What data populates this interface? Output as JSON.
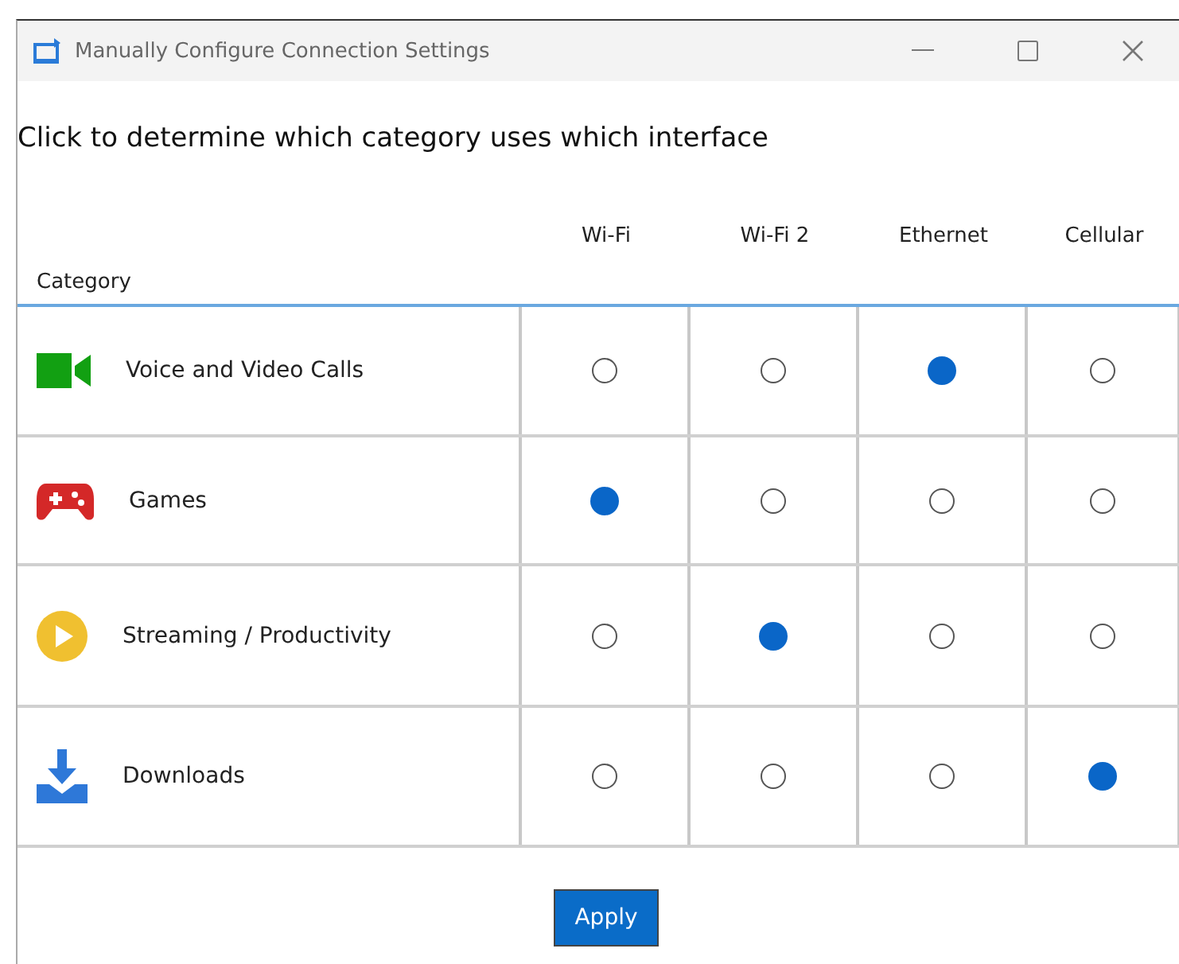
{
  "window": {
    "title": "Manually Configure Connection Settings"
  },
  "instruction": "Click to determine which category uses which interface",
  "table": {
    "category_header": "Category",
    "columns": [
      "Wi-Fi",
      "Wi-Fi 2",
      "Ethernet",
      "Cellular"
    ],
    "rows": [
      {
        "kind": "video",
        "label": "Voice and Video Calls",
        "options": [
          {
            "selected": false
          },
          {
            "selected": false
          },
          {
            "selected": true
          },
          {
            "selected": false
          }
        ]
      },
      {
        "kind": "games",
        "label": "Games",
        "options": [
          {
            "selected": true
          },
          {
            "selected": false
          },
          {
            "selected": false
          },
          {
            "selected": false
          }
        ]
      },
      {
        "kind": "streaming",
        "label": "Streaming / Productivity",
        "options": [
          {
            "selected": false
          },
          {
            "selected": true
          },
          {
            "selected": false
          },
          {
            "selected": false
          }
        ]
      },
      {
        "kind": "downloads",
        "label": "Downloads",
        "options": [
          {
            "selected": false
          },
          {
            "selected": false
          },
          {
            "selected": false
          },
          {
            "selected": true
          }
        ]
      }
    ]
  },
  "buttons": [
    "Apply"
  ]
}
